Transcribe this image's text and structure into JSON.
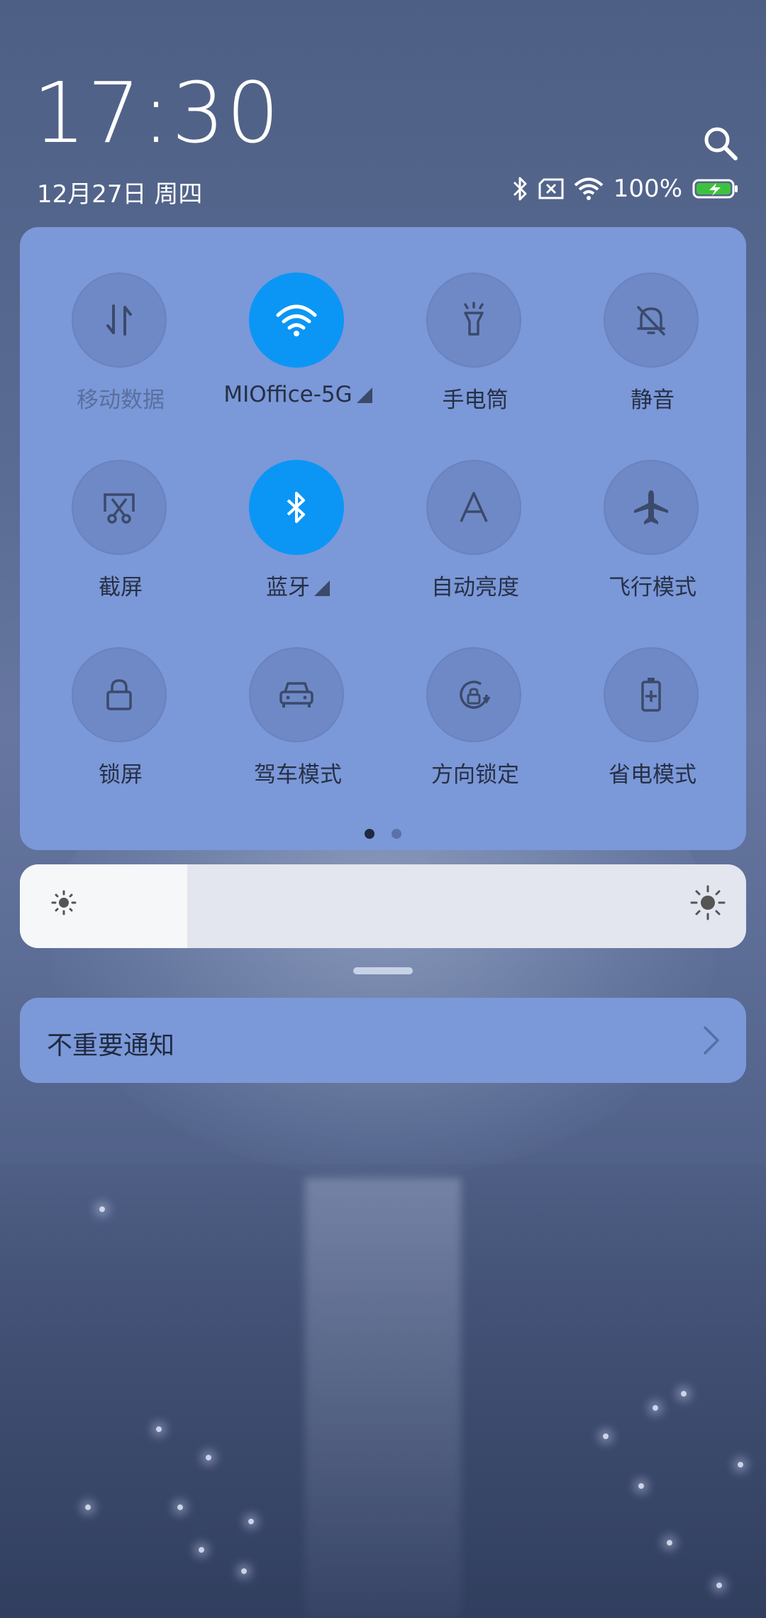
{
  "status_bar": {
    "time": "17:30",
    "date": "12月27日 周四",
    "battery": "100%"
  },
  "quick_tiles": [
    {
      "label": "移动数据",
      "icon": "mobile-data-icon",
      "active": false
    },
    {
      "label": "MIOffice-5G",
      "icon": "wifi-icon",
      "active": true
    },
    {
      "label": "手电筒",
      "icon": "flashlight-icon",
      "active": false
    },
    {
      "label": "静音",
      "icon": "mute-bell-icon",
      "active": false
    },
    {
      "label": "截屏",
      "icon": "screenshot-icon",
      "active": false
    },
    {
      "label": "蓝牙",
      "icon": "bluetooth-icon",
      "active": true
    },
    {
      "label": "自动亮度",
      "icon": "auto-brightness-icon",
      "active": false
    },
    {
      "label": "飞行模式",
      "icon": "airplane-icon",
      "active": false
    },
    {
      "label": "锁屏",
      "icon": "lock-icon",
      "active": false
    },
    {
      "label": "驾车模式",
      "icon": "car-icon",
      "active": false
    },
    {
      "label": "方向锁定",
      "icon": "rotation-lock-icon",
      "active": false
    },
    {
      "label": "省电模式",
      "icon": "battery-saver-icon",
      "active": false
    }
  ],
  "page_indicator": {
    "pages": 2,
    "current": 1
  },
  "brightness": {
    "level": 0.23
  },
  "notification": {
    "label": "不重要通知"
  },
  "colors": {
    "panel": "#7b98d8",
    "active_tile": "#0b96f5",
    "battery_green": "#3ec23e"
  }
}
